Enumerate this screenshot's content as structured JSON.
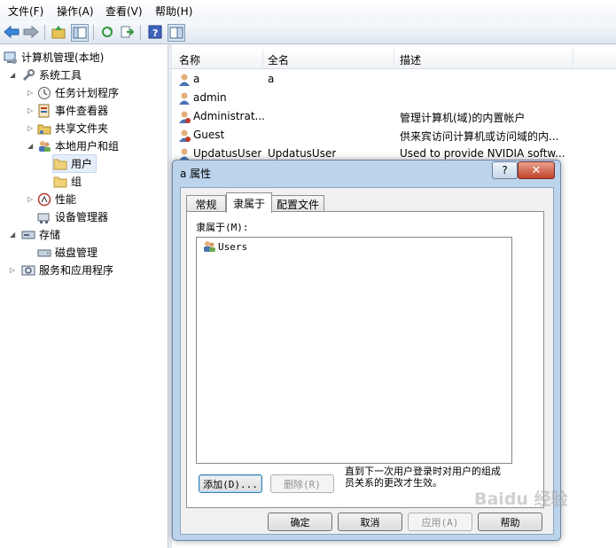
{
  "menubar": {
    "items": [
      "文件(F)",
      "操作(A)",
      "查看(V)",
      "帮助(H)"
    ]
  },
  "toolbar": {
    "icons": [
      "back-icon",
      "forward-icon",
      "up-icon",
      "show-hide-tree-icon",
      "refresh-icon",
      "export-icon",
      "help-icon",
      "properties-icon"
    ]
  },
  "tree": {
    "root": "计算机管理(本地)",
    "system_tools": "系统工具",
    "task_scheduler": "任务计划程序",
    "event_viewer": "事件查看器",
    "shared_folders": "共享文件夹",
    "local_users_groups": "本地用户和组",
    "users": "用户",
    "groups": "组",
    "performance": "性能",
    "device_manager": "设备管理器",
    "storage": "存储",
    "disk_management": "磁盘管理",
    "services_apps": "服务和应用程序"
  },
  "list": {
    "columns": [
      "名称",
      "全名",
      "描述"
    ],
    "rows": [
      {
        "name": "a",
        "fullname": "a",
        "desc": ""
      },
      {
        "name": "admin",
        "fullname": "",
        "desc": ""
      },
      {
        "name": "Administrat...",
        "fullname": "",
        "desc": "管理计算机(域)的内置帐户"
      },
      {
        "name": "Guest",
        "fullname": "",
        "desc": "供来宾访问计算机或访问域的内..."
      },
      {
        "name": "UpdatusUser",
        "fullname": "UpdatusUser",
        "desc": "Used to provide NVIDIA softw..."
      }
    ]
  },
  "dialog": {
    "title": "a 属性",
    "help_glyph": "?",
    "close_glyph": "✕",
    "tabs": [
      "常规",
      "隶属于",
      "配置文件"
    ],
    "member_of_label": "隶属于(M):",
    "groups": [
      "Users"
    ],
    "add_button": "添加(D)...",
    "remove_button": "删除(R)",
    "note": "直到下一次用户登录时对用户的组成员关系的更改才生效。",
    "ok_button": "确定",
    "cancel_button": "取消",
    "apply_button": "应用(A)",
    "help_button": "帮助"
  }
}
